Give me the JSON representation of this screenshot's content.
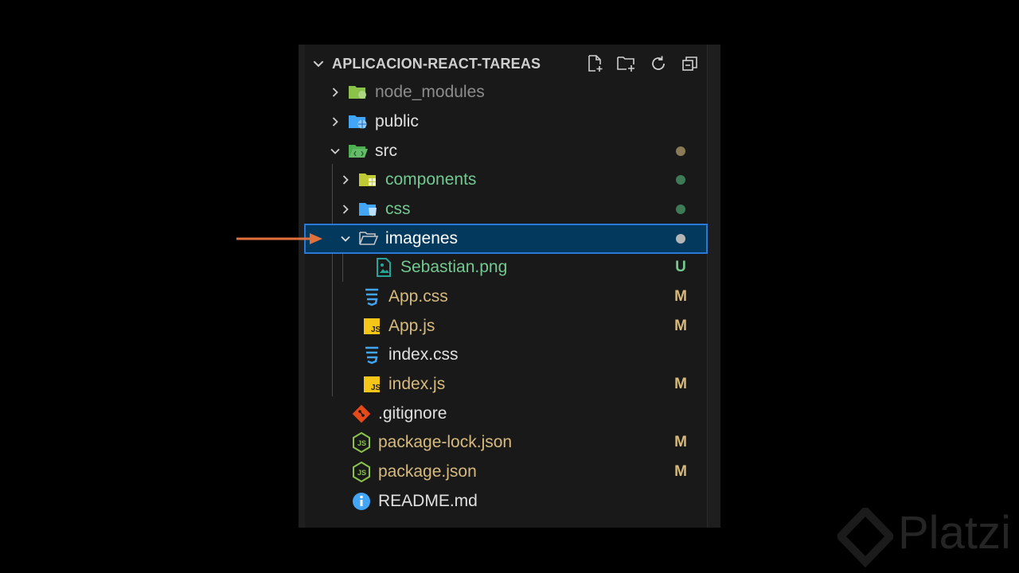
{
  "explorer": {
    "title": "APLICACION-REACT-TAREAS",
    "actions": [
      "new-file-icon",
      "new-folder-icon",
      "refresh-icon",
      "collapse-all-icon"
    ],
    "items": [
      {
        "name": "node_modules",
        "status": ""
      },
      {
        "name": "public",
        "status": ""
      },
      {
        "name": "src",
        "status": ""
      },
      {
        "name": "components",
        "status": ""
      },
      {
        "name": "css",
        "status": ""
      },
      {
        "name": "imagenes",
        "status": ""
      },
      {
        "name": "Sebastian.png",
        "status": "U"
      },
      {
        "name": "App.css",
        "status": "M"
      },
      {
        "name": "App.js",
        "status": "M"
      },
      {
        "name": "index.css",
        "status": ""
      },
      {
        "name": "index.js",
        "status": "M"
      },
      {
        "name": ".gitignore",
        "status": ""
      },
      {
        "name": "package-lock.json",
        "status": "M"
      },
      {
        "name": "package.json",
        "status": "M"
      },
      {
        "name": "README.md",
        "status": ""
      }
    ]
  },
  "watermark": {
    "text": "Platzi"
  },
  "colors": {
    "selected_bg": "#04395e",
    "selected_border": "#2b79d6",
    "modified": "#d7ba7d",
    "untracked": "#73c991",
    "arrow": "#e2703a"
  }
}
